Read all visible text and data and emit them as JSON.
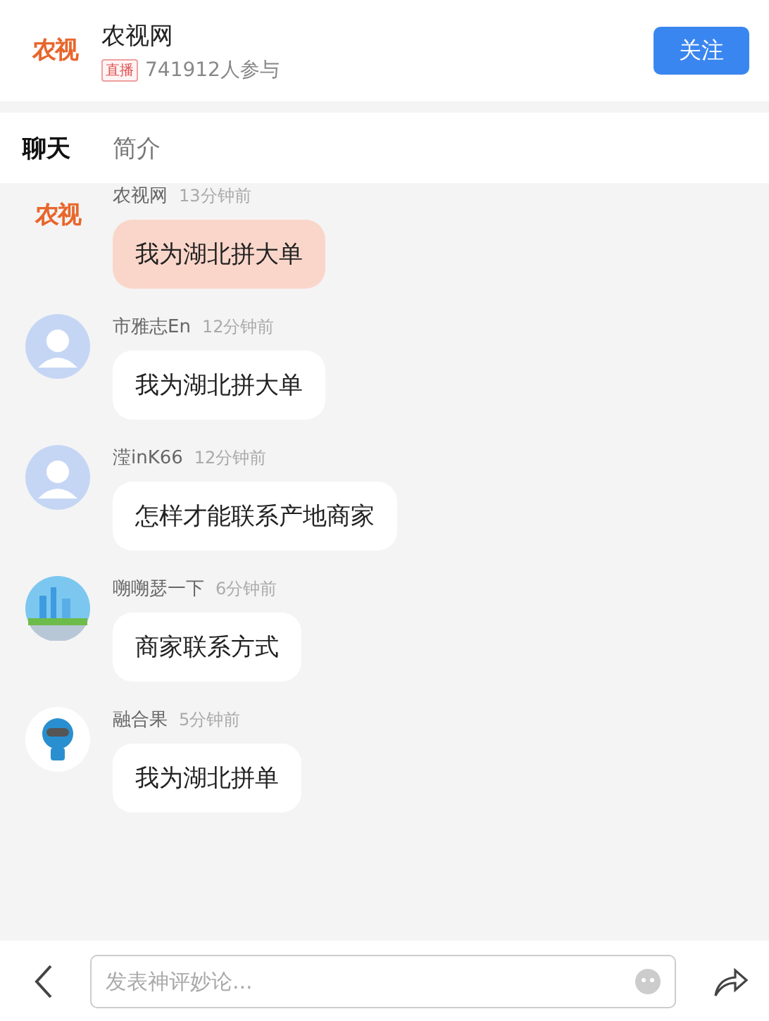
{
  "header": {
    "logo_text": "农视",
    "title": "农视网",
    "live_badge": "直播",
    "participants": "741912人参与",
    "follow_button": "关注"
  },
  "tabs": [
    {
      "label": "聊天",
      "selected": true
    },
    {
      "label": "简介",
      "selected": false
    }
  ],
  "messages": [
    {
      "kind": "logo",
      "logo_text": "农视",
      "name": "农视网",
      "time": "13分钟前",
      "text": "我为湖北拼大单",
      "highlighted": true
    },
    {
      "kind": "default",
      "name": "市雅志En",
      "time": "12分钟前",
      "text": "我为湖北拼大单",
      "highlighted": false
    },
    {
      "kind": "default",
      "name": "滢inK66",
      "time": "12分钟前",
      "text": "怎样才能联系产地商家",
      "highlighted": false
    },
    {
      "kind": "city",
      "name": "嗍嗍瑟一下",
      "time": "6分钟前",
      "text": "商家联系方式",
      "highlighted": false
    },
    {
      "kind": "robot",
      "name": "融合果",
      "time": "5分钟前",
      "text": "我为湖北拼单",
      "highlighted": false
    }
  ],
  "composer": {
    "placeholder": "发表神评妙论..."
  }
}
